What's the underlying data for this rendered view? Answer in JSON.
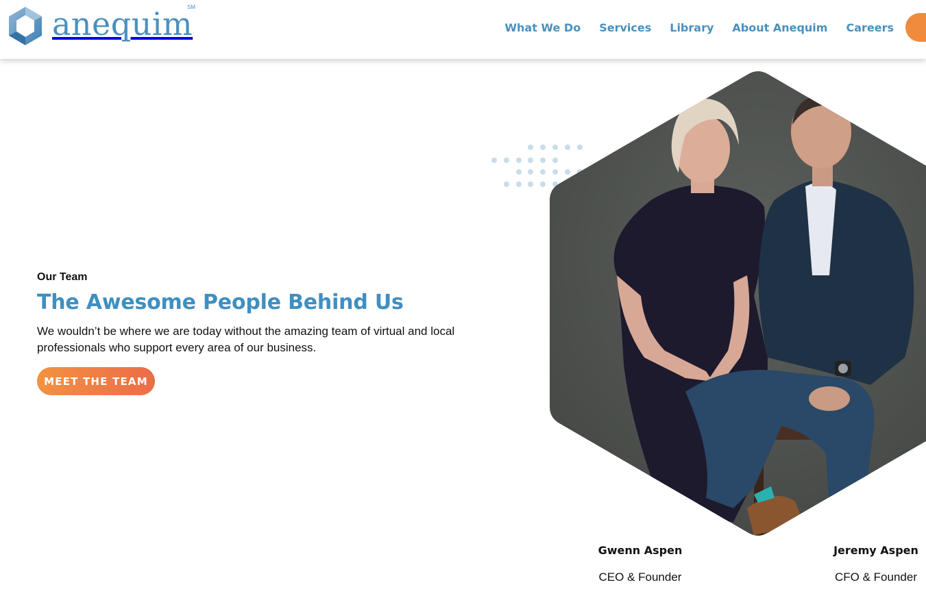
{
  "header": {
    "logo_text": "anequim",
    "logo_mark": "SM",
    "nav": [
      {
        "label": "What We Do"
      },
      {
        "label": "Services"
      },
      {
        "label": "Library"
      },
      {
        "label": "About Anequim"
      },
      {
        "label": "Careers"
      }
    ]
  },
  "hero": {
    "eyebrow": "Our Team",
    "headline": "The Awesome People Behind Us",
    "description": "We wouldn’t be where we are today without the amazing team of virtual and local professionals who support every area of our business.",
    "cta_label": "MEET THE TEAM"
  },
  "team": [
    {
      "name": "Gwenn Aspen",
      "role": "CEO & Founder"
    },
    {
      "name": "Jeremy Aspen",
      "role": "CFO & Founder"
    }
  ],
  "colors": {
    "brand_blue": "#4a90be",
    "headline_blue": "#3f8fc1",
    "cta_orange": "#f08a3c",
    "photo_backdrop": "#4d504d"
  },
  "icons": {
    "logo": "hexagon-logo-icon",
    "decoration": "dot-grid"
  }
}
